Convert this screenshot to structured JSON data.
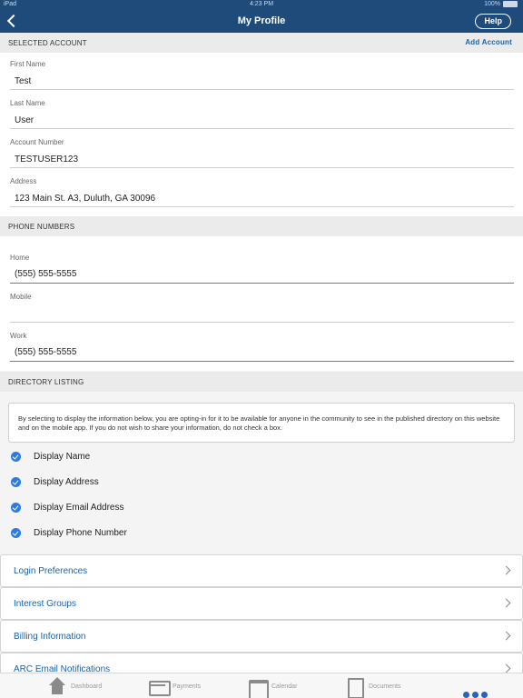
{
  "status": {
    "carrier": "iPad",
    "time": "4:23 PM",
    "battery": "100%"
  },
  "header": {
    "title": "My Profile",
    "help_label": "Help"
  },
  "account": {
    "section_label": "SELECTED ACCOUNT",
    "add_label": "Add Account",
    "fields": [
      {
        "label": "First Name",
        "value": "Test"
      },
      {
        "label": "Last Name",
        "value": "User"
      },
      {
        "label": "Account Number",
        "value": "TESTUSER123"
      },
      {
        "label": "Address",
        "value": "123  Main St. A3, Duluth, GA 30096"
      }
    ]
  },
  "phones": {
    "section_label": "PHONE NUMBERS",
    "fields": [
      {
        "label": "Home",
        "value": "(555) 555-5555"
      },
      {
        "label": "Mobile",
        "value": ""
      },
      {
        "label": "Work",
        "value": "(555) 555-5555"
      }
    ]
  },
  "directory": {
    "section_label": "DIRECTORY LISTING",
    "notice": "By selecting to display the information below, you are opting-in for it to be available for anyone in the community to see in the published directory on this website and on the mobile app. If you do not wish to share your information, do not check a box.",
    "options": [
      {
        "label": "Display Name",
        "checked": true
      },
      {
        "label": "Display Address",
        "checked": true
      },
      {
        "label": "Display Email Address",
        "checked": true
      },
      {
        "label": "Display Phone Number",
        "checked": true
      }
    ]
  },
  "nav_rows": [
    {
      "label": "Login Preferences"
    },
    {
      "label": "Interest Groups"
    },
    {
      "label": "Billing Information"
    },
    {
      "label": "ARC Email Notifications"
    }
  ],
  "tabs": [
    {
      "label": "Dashboard",
      "icon": "home-icon"
    },
    {
      "label": "Payments",
      "icon": "card-icon"
    },
    {
      "label": "Calendar",
      "icon": "calendar-icon"
    },
    {
      "label": "Documents",
      "icon": "document-icon"
    }
  ],
  "colors": {
    "nav_bar": "#1f4b7a",
    "accent": "#1e62a8",
    "check": "#2c7be5",
    "active_field_line": "#4c9a4c"
  }
}
